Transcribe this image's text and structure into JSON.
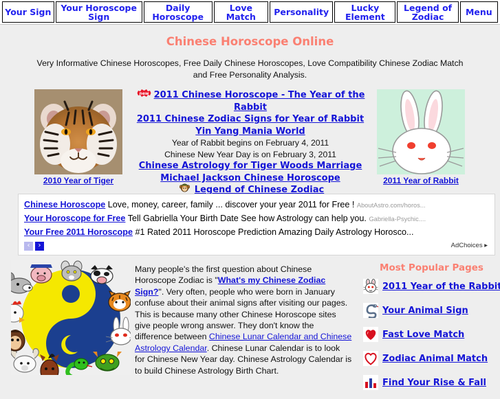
{
  "nav": {
    "items": [
      {
        "label": "Your Sign",
        "name": "nav-your-sign"
      },
      {
        "label": "Your Horoscope Sign",
        "name": "nav-your-horoscope-sign"
      },
      {
        "label": "Daily Horoscope",
        "name": "nav-daily-horoscope"
      },
      {
        "label": "Love Match",
        "name": "nav-love-match"
      },
      {
        "label": "Personality",
        "name": "nav-personality"
      },
      {
        "label": "Lucky Element",
        "name": "nav-lucky-element"
      },
      {
        "label": "Legend of Zodiac",
        "name": "nav-legend-of-zodiac"
      },
      {
        "label": "Menu",
        "name": "nav-menu"
      }
    ]
  },
  "header": {
    "title": "Chinese Horoscope Online",
    "subtitle": "Very Informative Chinese Horoscopes, Free Daily Chinese Horoscopes, Love Compatibility Chinese Zodiac Match and Free Personality Analysis."
  },
  "hero": {
    "new_badge": "new",
    "link1": "2011 Chinese Horoscope - The Year of the Rabbit",
    "link2": "2011 Chinese Zodiac Signs for Year of Rabbit",
    "link3": "Yin Yang Mania World",
    "plain1": "Year of Rabbit begins on February 4, 2011",
    "plain2": "Chinese New Year Day is on February 3, 2011",
    "link4": "Chinese Astrology for Tiger Woods Marriage",
    "link5": "Michael Jackson Chinese Horoscope",
    "link6": "Legend of Chinese Zodiac",
    "left_caption": "2010 Year of Tiger",
    "right_caption": "2011 Year of Rabbit",
    "left_image_alt": "tiger-photo",
    "right_image_alt": "rabbit-drawing"
  },
  "ads": {
    "rows": [
      {
        "title": "Chinese Horoscope",
        "text": "Love, money, career, family ... discover your year 2011 for Free !",
        "url": "AboutAstro.com/horos..."
      },
      {
        "title": "Your Horoscope for Free",
        "text": "Tell Gabriella Your Birth Date See how Astrology can help you.",
        "url": "Gabriella-Psychic...."
      },
      {
        "title": "Your Free 2011 Horoscope",
        "text": "#1 Rated 2011 Horoscope Prediction Amazing Daily Astrology Horosco...",
        "url": ""
      }
    ],
    "prev_label": "‹",
    "next_label": "›",
    "adchoices": "AdChoices"
  },
  "article": {
    "p1a": "Many people's the first question about Chinese Horoscope Zodiac is \"",
    "link_zodiac_sign": "What's my Chinese Zodiac Sign?",
    "p1b": "\". Very often, people who were born in January confuse about their animal signs after visiting our pages. This is because many other Chinese Horoscope sites give people wrong answer. They don't know the difference between ",
    "link_calendar": "Chinese Lunar Calendar and Chinese Astrology Calendar",
    "p1c": ". Chinese Lunar Calendar is to look for Chinese New Year day. Chinese Astrology Calendar is to build Chinese Astrology Birth Chart."
  },
  "popular": {
    "title": "Most Popular Pages",
    "items": [
      {
        "label": "2011 Year of the Rabbit",
        "icon": "rabbit-icon"
      },
      {
        "label": "Your Animal Sign",
        "icon": "snake-icon"
      },
      {
        "label": "Fast Love Match",
        "icon": "heart-filled-icon"
      },
      {
        "label": "Zodiac Animal Match",
        "icon": "heart-outline-icon"
      },
      {
        "label": "Find Your Rise & Fall",
        "icon": "bar-chart-icon"
      }
    ]
  },
  "yinyang": {
    "alt": "yin-yang-zodiac-animals-image"
  },
  "colors": {
    "link": "#1414d7",
    "title": "#fa8072",
    "nav_text": "#2222ee",
    "page_bg": "#eeeeee"
  }
}
